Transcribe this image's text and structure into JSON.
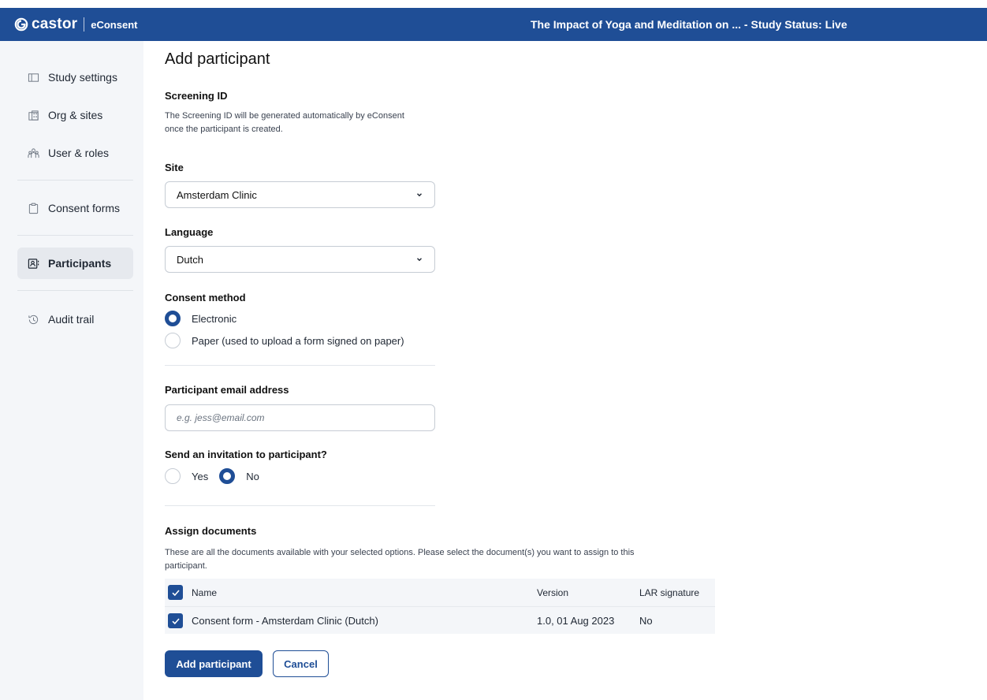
{
  "header": {
    "brand_name": "castor",
    "product_name": "eConsent",
    "study_title": "The Impact of Yoga and Meditation on ... - Study Status: Live",
    "color": "#1f4e96"
  },
  "sidebar": {
    "items": [
      {
        "label": "Study settings",
        "icon": "layout-icon"
      },
      {
        "label": "Org & sites",
        "icon": "building-icon"
      },
      {
        "label": "User & roles",
        "icon": "users-icon"
      },
      {
        "label": "Consent forms",
        "icon": "clipboard-icon"
      },
      {
        "label": "Participants",
        "icon": "participants-icon",
        "active": true
      },
      {
        "label": "Audit trail",
        "icon": "history-icon"
      }
    ]
  },
  "form": {
    "title": "Add participant",
    "screening": {
      "label": "Screening ID",
      "help_line1": "The Screening ID will be generated automatically by eConsent",
      "help_line2": "once the participant is created."
    },
    "site": {
      "label": "Site",
      "value": "Amsterdam Clinic"
    },
    "language": {
      "label": "Language",
      "value": "Dutch"
    },
    "consent_method": {
      "label": "Consent method",
      "options": [
        {
          "label": "Electronic",
          "checked": true
        },
        {
          "label": "Paper (used to upload a form signed on paper)",
          "checked": false
        }
      ]
    },
    "email": {
      "label": "Participant email address",
      "placeholder": "e.g. jess@email.com",
      "value": ""
    },
    "invitation": {
      "label": "Send an invitation to participant?",
      "options": [
        {
          "label": "Yes",
          "checked": false
        },
        {
          "label": "No",
          "checked": true
        }
      ]
    },
    "documents": {
      "label": "Assign documents",
      "help_line1": "These are all the documents available with your selected options. Please select the document(s) you want to assign to this",
      "help_line2": "participant.",
      "columns": {
        "name": "Name",
        "version": "Version",
        "lar": "LAR signature"
      },
      "rows": [
        {
          "name": "Consent form - Amsterdam Clinic (Dutch)",
          "version": "1.0, 01 Aug 2023",
          "lar": "No",
          "checked": true
        }
      ]
    },
    "buttons": {
      "submit": "Add participant",
      "cancel": "Cancel"
    }
  }
}
